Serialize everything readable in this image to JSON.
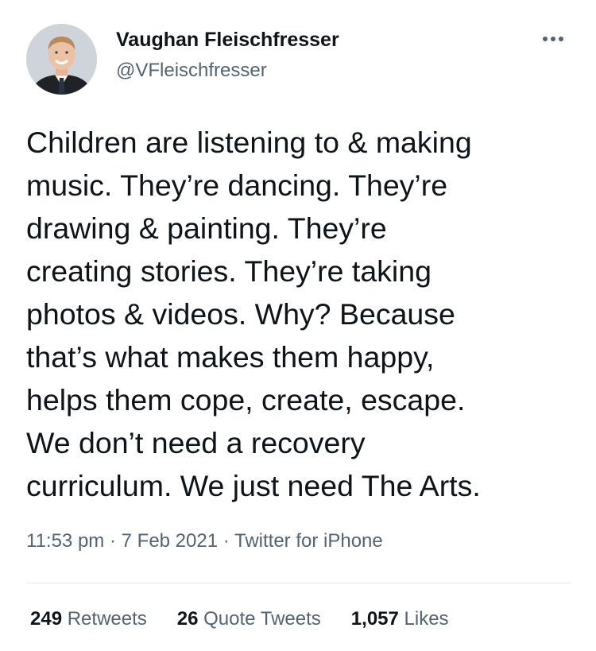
{
  "tweet": {
    "author": {
      "name": "Vaughan Fleischfresser",
      "handle": "@VFleischfresser"
    },
    "more_icon": "more-horizontal-icon",
    "text": "Children are listening to & making\nmusic. They’re dancing. They’re\ndrawing & painting. They’re\ncreating stories. They’re taking\nphotos & videos. Why? Because\nthat’s what makes them happy,\nhelps them cope, create, escape.\nWe don’t need a recovery\ncurriculum. We just need The Arts.",
    "time": "11:53 pm",
    "separator": "·",
    "date": "7 Feb 2021",
    "source": "Twitter for iPhone",
    "stats": {
      "retweets": {
        "count": "249",
        "label": "Retweets"
      },
      "quote_tweets": {
        "count": "26",
        "label": "Quote Tweets"
      },
      "likes": {
        "count": "1,057",
        "label": "Likes"
      }
    }
  },
  "colors": {
    "primary_text": "#0f1419",
    "secondary_text": "#536471",
    "divider": "#e4e8ec"
  }
}
